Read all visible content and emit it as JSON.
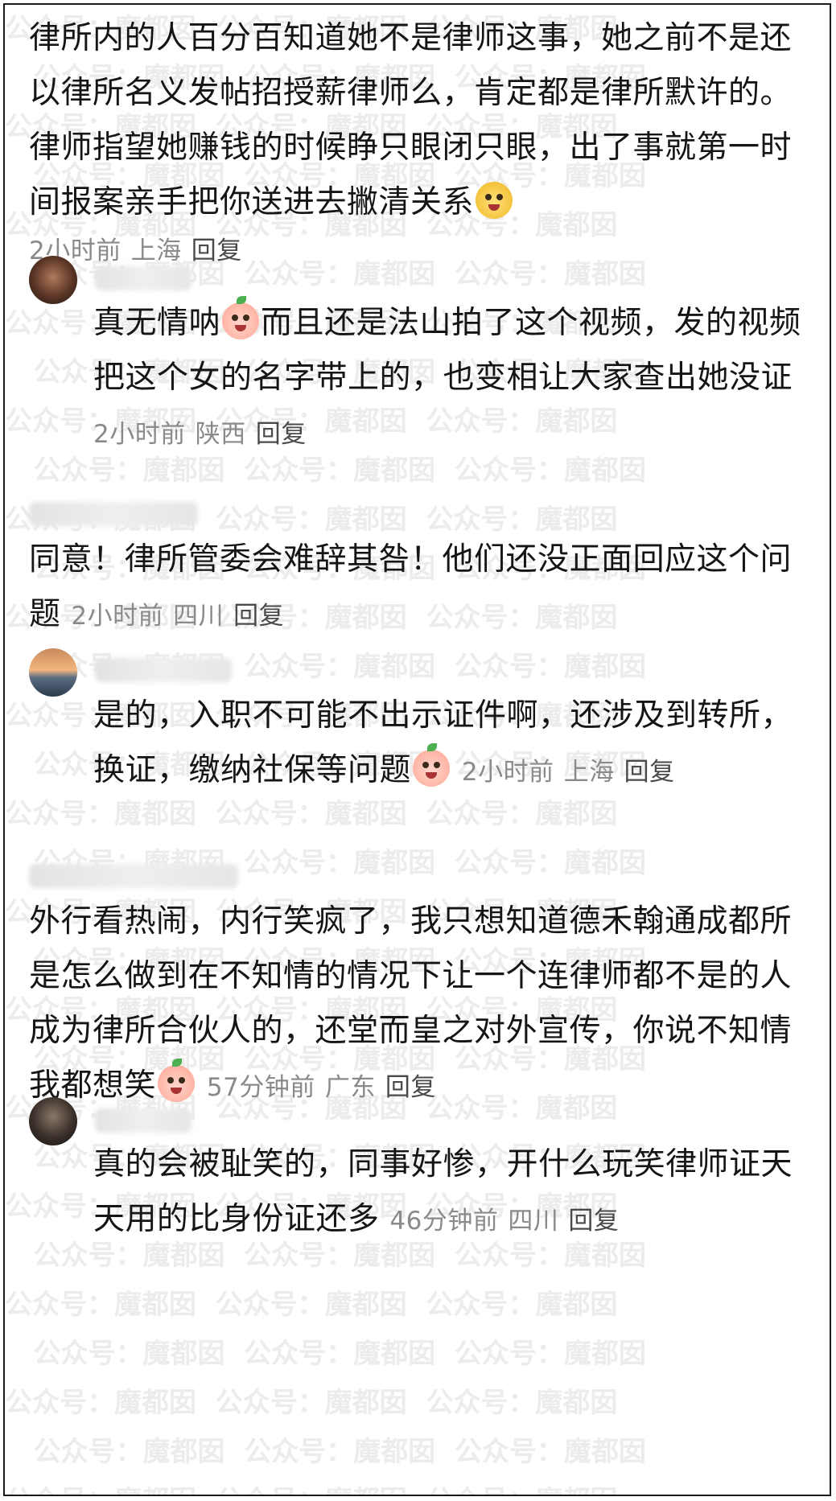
{
  "watermark": {
    "text": "公众号：魔都囡  公众号：魔都囡  公众号：魔都囡"
  },
  "comments": [
    {
      "text": "律所内的人百分百知道她不是律师这事，她之前不是还以律所名义发帖招授薪律师么，肯定都是律所默许的。律师指望她赚钱的时候睁只眼闭只眼，出了事就第一时间报案亲手把你送进去撇清关系",
      "emoji": "yellow-dog-emoji",
      "time": "2小时前",
      "location": "上海",
      "reply": "回复"
    },
    {
      "text_before_emoji": "真无情呐",
      "text_after_emoji": "而且还是法山拍了这个视频，发的视频把这个女的名字带上的，也变相让大家查出她没证",
      "emoji": "peach-emoji",
      "time": "2小时前",
      "location": "陕西",
      "reply": "回复"
    },
    {
      "text": "同意！律所管委会难辞其咎！他们还没正面回应这个问题",
      "time": "2小时前",
      "location": "四川",
      "reply": "回复"
    },
    {
      "text": "是的，入职不可能不出示证件啊，还涉及到转所，换证，缴纳社保等问题",
      "emoji": "crying-peach-emoji",
      "time": "2小时前",
      "location": "上海",
      "reply": "回复"
    },
    {
      "text": "外行看热闹，内行笑疯了，我只想知道德禾翰通成都所是怎么做到在不知情的情况下让一个连律师都不是的人成为律所合伙人的，还堂而皇之对外宣传，你说不知情我都想笑",
      "emoji": "peach-emoji",
      "time": "57分钟前",
      "location": "广东",
      "reply": "回复"
    },
    {
      "text": "真的会被耻笑的，同事好惨，开什么玩笑律师证天天用的比身份证还多",
      "time": "46分钟前",
      "location": "四川",
      "reply": "回复"
    }
  ]
}
